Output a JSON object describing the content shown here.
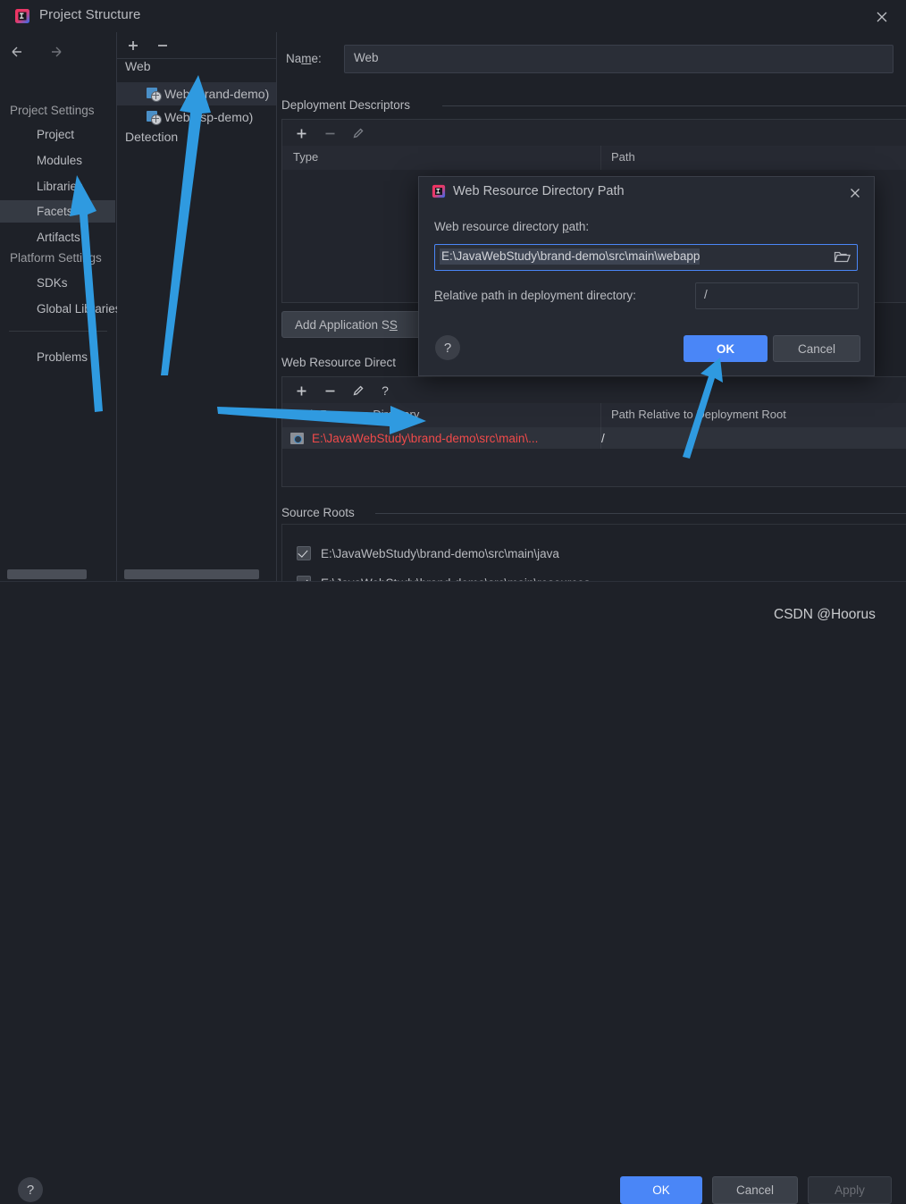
{
  "window": {
    "title": "Project Structure",
    "app_icon": "intellij-idea-icon",
    "close_icon": "close-icon"
  },
  "sidebar": {
    "back_icon": "arrow-left-icon",
    "forward_icon": "arrow-right-icon",
    "groups": [
      {
        "title": "Project Settings"
      },
      {
        "title": "Platform Settings"
      }
    ],
    "items": [
      {
        "label": "Project",
        "selected": false
      },
      {
        "label": "Modules",
        "selected": false
      },
      {
        "label": "Libraries",
        "selected": false
      },
      {
        "label": "Facets",
        "selected": true
      },
      {
        "label": "Artifacts",
        "selected": false
      },
      {
        "label": "SDKs",
        "selected": false
      },
      {
        "label": "Global Libraries",
        "selected": false
      },
      {
        "label": "Problems",
        "selected": false
      }
    ]
  },
  "facet_tree": {
    "toolbar": {
      "add_icon": "plus-icon",
      "remove_icon": "minus-icon"
    },
    "nodes": [
      {
        "label": "Web",
        "type": "group",
        "selected": false
      },
      {
        "label": "Web (brand-demo)",
        "type": "facet",
        "selected": true
      },
      {
        "label": "Web (jsp-demo)",
        "type": "facet",
        "selected": false
      },
      {
        "label": "Detection",
        "type": "group",
        "selected": false
      }
    ]
  },
  "facet_panel": {
    "name_label": "Name:",
    "name_value": "Web",
    "deployment_descriptors": {
      "title": "Deployment Descriptors",
      "toolbar": [
        "plus-icon",
        "minus-icon",
        "pencil-icon"
      ],
      "columns": [
        "Type",
        "Path"
      ],
      "rows": []
    },
    "add_application_server_button": "Add Application S",
    "web_resource_directories": {
      "title": "Web Resource Direct",
      "toolbar": [
        "plus-icon",
        "minus-icon",
        "pencil-icon",
        "help-icon"
      ],
      "columns": [
        "Web Resource Directory",
        "Path Relative to Deployment Root"
      ],
      "rows": [
        {
          "directory": "E:\\JavaWebStudy\\brand-demo\\src\\main\\...",
          "relative_path": "/",
          "error": true,
          "icon": "web-directory-icon"
        }
      ]
    },
    "source_roots": {
      "title": "Source Roots",
      "items": [
        {
          "path": "E:\\JavaWebStudy\\brand-demo\\src\\main\\java",
          "checked": true
        },
        {
          "path": "E:\\JavaWebStudy\\brand-demo\\src\\main\\resources",
          "checked": true
        }
      ]
    }
  },
  "dialog": {
    "icon": "intellij-idea-icon",
    "title": "Web Resource Directory Path",
    "close_icon": "close-icon",
    "path_label_pre": "Web resource directory ",
    "path_label_mnemonic": "p",
    "path_label_post": "ath:",
    "path_value": "E:\\JavaWebStudy\\brand-demo\\src\\main\\webapp",
    "browse_icon": "folder-icon",
    "relative_label_mnemonic": "R",
    "relative_label_post": "elative path in deployment directory:",
    "relative_value": "/",
    "help_icon": "help-icon",
    "ok_label": "OK",
    "cancel_label": "Cancel"
  },
  "footer": {
    "help_icon": "help-icon",
    "ok_label": "OK",
    "cancel_label": "Cancel",
    "apply_label": "Apply"
  },
  "watermark": "CSDN @Hoorus",
  "colors": {
    "accent": "#4a86f7",
    "error_text": "#f04a4a",
    "arrow": "#2f9ae0",
    "background": "#1e2128",
    "panel": "#262a33",
    "facet_icon": "#4a8fc7"
  }
}
